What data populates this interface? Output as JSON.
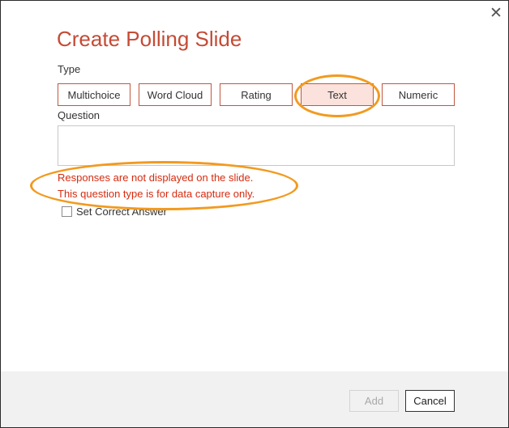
{
  "dialog": {
    "title": "Create Polling Slide",
    "close_glyph": "✕"
  },
  "type_section": {
    "label": "Type",
    "options": [
      "Multichoice",
      "Word Cloud",
      "Rating",
      "Text",
      "Numeric"
    ],
    "selected": "Text"
  },
  "question": {
    "label": "Question",
    "value": "",
    "placeholder": ""
  },
  "info": {
    "line1": "Responses are not displayed on the slide.",
    "line2": "This question type is for data capture only."
  },
  "correct_answer": {
    "label": "Set Correct Answer",
    "checked": false
  },
  "footer": {
    "add_label": "Add",
    "cancel_label": "Cancel",
    "add_enabled": false
  },
  "colors": {
    "title": "#c64a34",
    "button_border": "#c05740",
    "selected_fill": "#fbe2dc",
    "warning_text": "#d62b0f",
    "annotation": "#f29a1f",
    "footer_bg": "#f1f1f1"
  }
}
